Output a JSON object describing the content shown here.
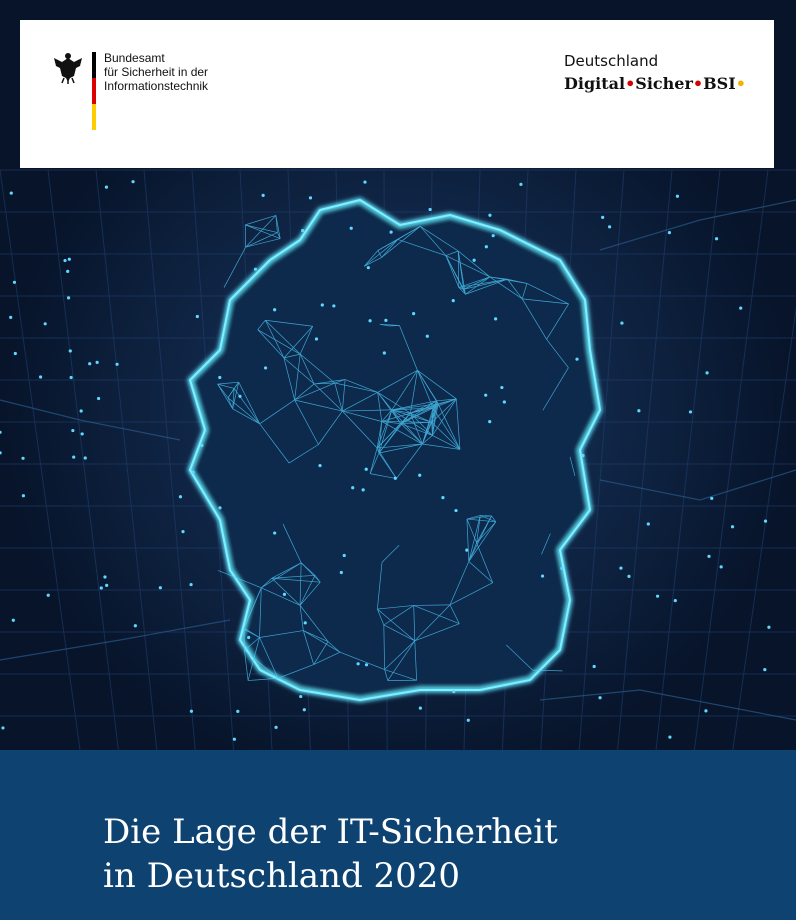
{
  "agency": {
    "line1": "Bundesamt",
    "line2": "für Sicherheit in der",
    "line3": "Informationstechnik",
    "flag_colors": [
      "#000000",
      "#dd0000",
      "#ffcc00"
    ]
  },
  "brand": {
    "top": "Deutschland",
    "word1": "Digital",
    "word2": "Sicher",
    "word3": "BSI",
    "dot_color_red": "#d40000",
    "dot_color_yellow": "#f0b400"
  },
  "title": {
    "line1": "Die Lage der IT-Sicherheit",
    "line2": "in Deutschland 2020"
  },
  "colors": {
    "band": "#0d4271",
    "map_background": "#0b1a33",
    "network": "#4fd0ff"
  },
  "icons": {
    "eagle": "federal-eagle-icon",
    "map": "germany-network-map"
  }
}
